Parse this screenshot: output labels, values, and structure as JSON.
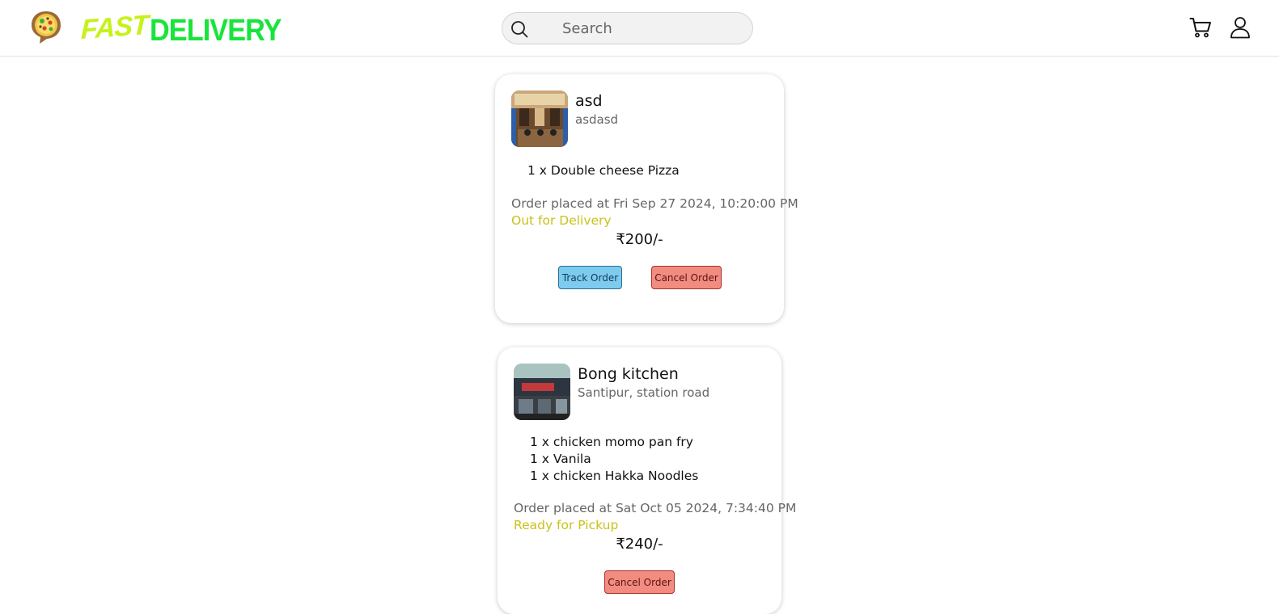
{
  "header": {
    "brand_part1": "FAST",
    "brand_part2": "DELIVERY",
    "search_placeholder": "Search"
  },
  "orders": [
    {
      "restaurant_name": "asd",
      "restaurant_address": "asdasd",
      "items": [
        "1 x Double cheese Pizza"
      ],
      "placed_at": "Order placed at Fri Sep 27 2024, 10:20:00 PM",
      "status": "Out for Delivery",
      "price": "₹200/-",
      "track_label": "Track Order",
      "cancel_label": "Cancel Order"
    },
    {
      "restaurant_name": "Bong kitchen",
      "restaurant_address": "Santipur, station road",
      "items": [
        "1 x chicken momo pan fry",
        "1 x Vanila",
        "1 x chicken Hakka Noodles"
      ],
      "placed_at": "Order placed at Sat Oct 05 2024, 7:34:40 PM",
      "status": "Ready for Pickup",
      "price": "₹240/-",
      "cancel_label": "Cancel Order"
    }
  ],
  "colors": {
    "status": "#c9c21a",
    "track_button": "#7ecbf0",
    "cancel_button": "#f28b80",
    "brand_fast": "#c6f21a",
    "brand_delivery": "#19e43c"
  },
  "icons": [
    "pizza-logo-icon",
    "search-icon",
    "cart-icon",
    "user-icon"
  ]
}
